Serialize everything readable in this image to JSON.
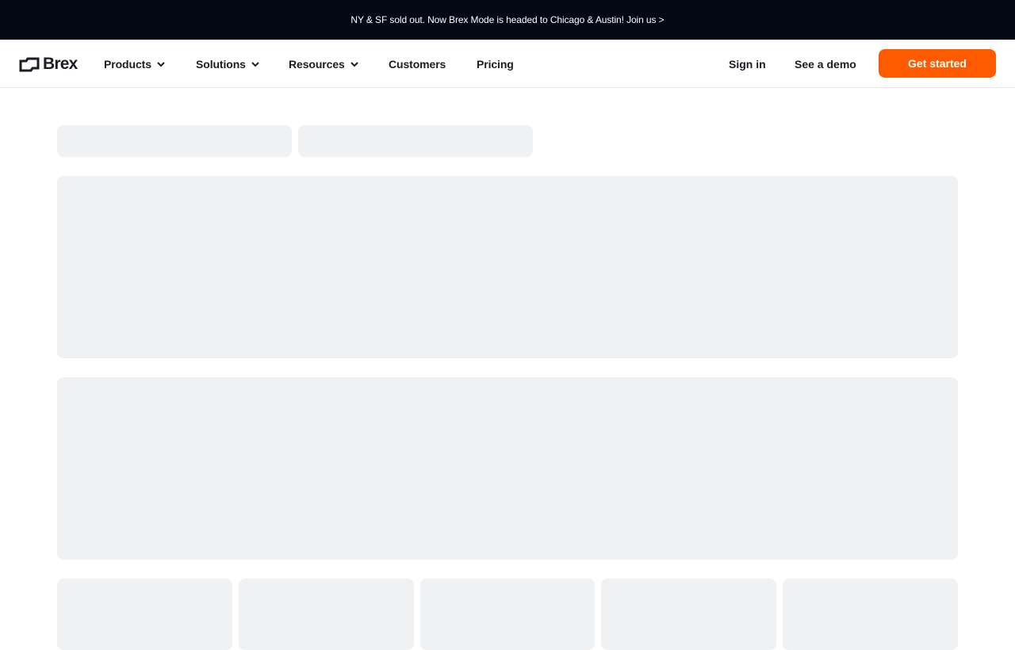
{
  "banner": {
    "text": "NY & SF sold out. Now Brex Mode is headed to Chicago & Austin! Join us >"
  },
  "brand": {
    "name": "Brex",
    "accent": "#ff5a00",
    "banner_bg": "#020814",
    "skeleton": "#f0f1f3"
  },
  "nav": {
    "items": [
      {
        "label": "Products",
        "icon": "chevron-down-icon"
      },
      {
        "label": "Solutions",
        "icon": "chevron-down-icon"
      },
      {
        "label": "Resources",
        "icon": "chevron-down-icon"
      },
      {
        "label": "Customers"
      },
      {
        "label": "Pricing"
      }
    ],
    "sign_in": "Sign in",
    "demo": "See a demo",
    "cta": "Get started"
  }
}
